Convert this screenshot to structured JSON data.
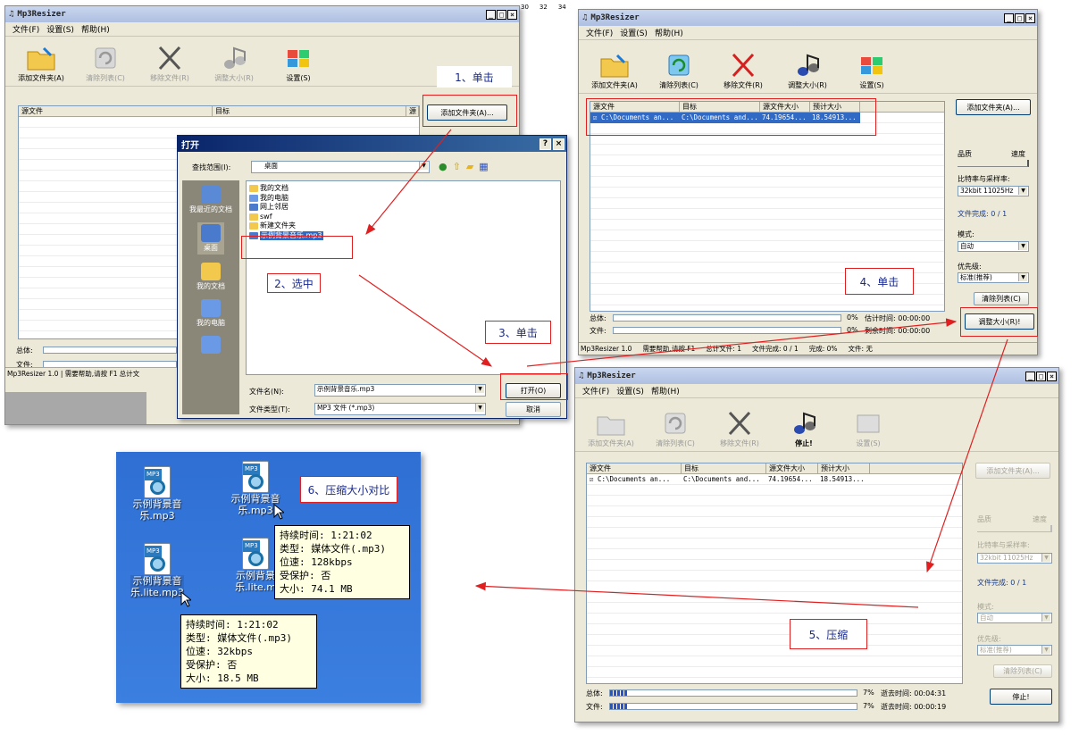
{
  "win1": {
    "title": "Mp3Resizer",
    "menu": [
      "文件(F)",
      "设置(S)",
      "帮助(H)"
    ],
    "toolbar": [
      "添加文件夹(A)",
      "清除列表(C)",
      "移除文件(R)",
      "调整大小(R)",
      "设置(S)"
    ],
    "columns": [
      "源文件",
      "目标",
      "源"
    ],
    "add_button": "添加文件夹(A)...",
    "total_label": "总体:",
    "file_label": "文件:",
    "status": "Mp3Resizer 1.0 | 需要帮助,请按 F1",
    "status2": "总计文"
  },
  "ruler": [
    "30",
    "32",
    "34"
  ],
  "dialog": {
    "title": "打开",
    "lookin_label": "查找范围(I):",
    "lookin_value": "桌面",
    "places": [
      "我最近的文档",
      "桌面",
      "我的文档",
      "我的电脑",
      ""
    ],
    "files": [
      "我的文档",
      "我的电脑",
      "网上邻居",
      "swf",
      "新建文件夹",
      "示例背景音乐.mp3"
    ],
    "filename_label": "文件名(N):",
    "filename_value": "示例背景音乐.mp3",
    "filetype_label": "文件类型(T):",
    "filetype_value": "MP3 文件 (*.mp3)",
    "open_button": "打开(O)",
    "cancel_button": "取消"
  },
  "win2": {
    "title": "Mp3Resizer",
    "menu": [
      "文件(F)",
      "设置(S)",
      "帮助(H)"
    ],
    "toolbar": [
      "添加文件夹(A)",
      "清除列表(C)",
      "移除文件(R)",
      "调整大小(R)",
      "设置(S)"
    ],
    "columns": [
      "源文件",
      "目标",
      "源文件大小",
      "预计大小"
    ],
    "row": [
      "C:\\Documents an...",
      "C:\\Documents and...",
      "74.19654...",
      "18.54913..."
    ],
    "add_button": "添加文件夹(A)...",
    "quality": "品质",
    "speed": "速度",
    "bitrate_label": "比特率与采样率:",
    "bitrate_value": "32kbit 11025Hz",
    "done_label": "文件完成: 0 / 1",
    "mode_label": "模式:",
    "mode_value": "自动",
    "priority_label": "优先级:",
    "priority_value": "标准(推荐)",
    "clear_button": "清除列表(C)",
    "resize_button": "调整大小(R)!",
    "total_label": "总体:",
    "file_label": "文件:",
    "pct1": "0%",
    "pct2": "0%",
    "est_time": "估计时间: 00:00:00",
    "remain_time": "剩余时间: 00:00:00",
    "status": [
      "Mp3Resizer 1.0",
      "需要帮助,请按 F1",
      "总计文件: 1",
      "文件完成: 0 / 1",
      "完成: 0%",
      "文件: 无"
    ]
  },
  "win3": {
    "title": "Mp3Resizer",
    "menu": [
      "文件(F)",
      "设置(S)",
      "帮助(H)"
    ],
    "toolbar": [
      "添加文件夹(A)",
      "清除列表(C)",
      "移除文件(R)",
      "停止!",
      "设置(S)"
    ],
    "columns": [
      "源文件",
      "目标",
      "源文件大小",
      "预计大小"
    ],
    "row": [
      "C:\\Documents an...",
      "C:\\Documents and...",
      "74.19654...",
      "18.54913..."
    ],
    "add_button": "添加文件夹(A)...",
    "quality": "品质",
    "speed": "速度",
    "bitrate_label": "比特率与采样率:",
    "bitrate_value": "32kbit 11025Hz",
    "done_label": "文件完成: 0 / 1",
    "mode_label": "模式:",
    "mode_value": "自动",
    "priority_label": "优先级:",
    "priority_value": "标准(推荐)",
    "clear_button": "清除列表(C)",
    "stop_button": "停止!",
    "total_label": "总体:",
    "file_label": "文件:",
    "total_progress": 0.07,
    "file_progress": 0.07,
    "pct1": "7%",
    "pct2": "7%",
    "elapsed1": "逝去时间: 00:04:31",
    "elapsed2": "逝去时间: 00:00:19"
  },
  "annotations": {
    "a1": "1、单击",
    "a2": "2、选中",
    "a3": "3、单击",
    "a4": "4、单击",
    "a5": "5、压缩",
    "a6": "6、压缩大小对比"
  },
  "desktop": {
    "icon1": "示例背景音\n乐.mp3",
    "icon2": "示例背景音\n乐.mp3",
    "icon3": "示例背景音\n乐.lite.mp3",
    "icon4": "示例背景\n乐.lite.m",
    "mp3_badge": "MP3",
    "tip1": [
      "持续时间: 1:21:02",
      "类型: 媒体文件(.mp3)",
      "位速: 128kbps",
      "受保护: 否",
      "大小: 74.1 MB"
    ],
    "tip2": [
      "持续时间: 1:21:02",
      "类型: 媒体文件(.mp3)",
      "位速: 32kbps",
      "受保护: 否",
      "大小: 18.5 MB"
    ]
  },
  "colors": {
    "arrow": "#e02020",
    "accent": "#1a3c8c"
  }
}
